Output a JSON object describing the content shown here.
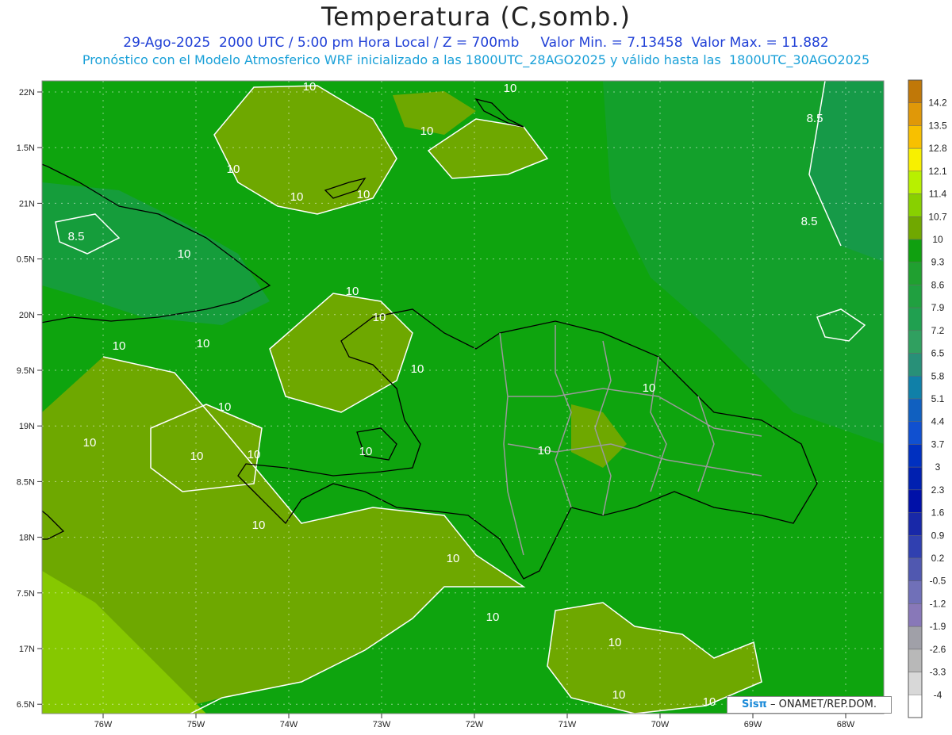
{
  "header": {
    "title": "Temperatura (C,somb.)",
    "line1": "29-Ago-2025  2000 UTC / 5:00 pm Hora Local / Z = 700mb     Valor Min. = 7.13458  Valor Max. = 11.882",
    "line2": "Pronóstico con el Modelo Atmosferico WRF inicializado a las 1800UTC_28AGO2025 y válido hasta las  1800UTC_30AGO2025"
  },
  "axes": {
    "lat_labels": [
      "22N",
      "1.5N",
      "21N",
      "0.5N",
      "20N",
      "9.5N",
      "19N",
      "8.5N",
      "18N",
      "7.5N",
      "17N",
      "6.5N"
    ],
    "lon_labels": [
      "76W",
      "75W",
      "74W",
      "73W",
      "72W",
      "71W",
      "70W",
      "69W",
      "68W"
    ]
  },
  "legend": {
    "levels": [
      "14.2",
      "13.5",
      "12.8",
      "12.1",
      "11.4",
      "10.7",
      "10",
      "9.3",
      "8.6",
      "7.9",
      "7.2",
      "6.5",
      "5.8",
      "5.1",
      "4.4",
      "3.7",
      "3",
      "2.3",
      "1.6",
      "0.9",
      "0.2",
      "-0.5",
      "-1.2",
      "-1.9",
      "-2.6",
      "-3.3",
      "-4"
    ],
    "colors": [
      "#c07808",
      "#e09808",
      "#f8c000",
      "#f8f000",
      "#b8f000",
      "#88d000",
      "#70a800",
      "#10a010",
      "#20a030",
      "#20a040",
      "#20a050",
      "#30a060",
      "#289078",
      "#1080a8",
      "#1060c0",
      "#1050d0",
      "#0030c0",
      "#0020b0",
      "#0010a8",
      "#1828a8",
      "#3040b0",
      "#5058b0",
      "#7070b8",
      "#8878b8",
      "#a0a0a8",
      "#b8b8b8",
      "#d8d8d8",
      "#ffffff"
    ]
  },
  "contour_labels": [
    "10",
    "8.5"
  ],
  "credit": {
    "logo": "Sisπ",
    "text": " – ONAMET/REP.DOM."
  }
}
